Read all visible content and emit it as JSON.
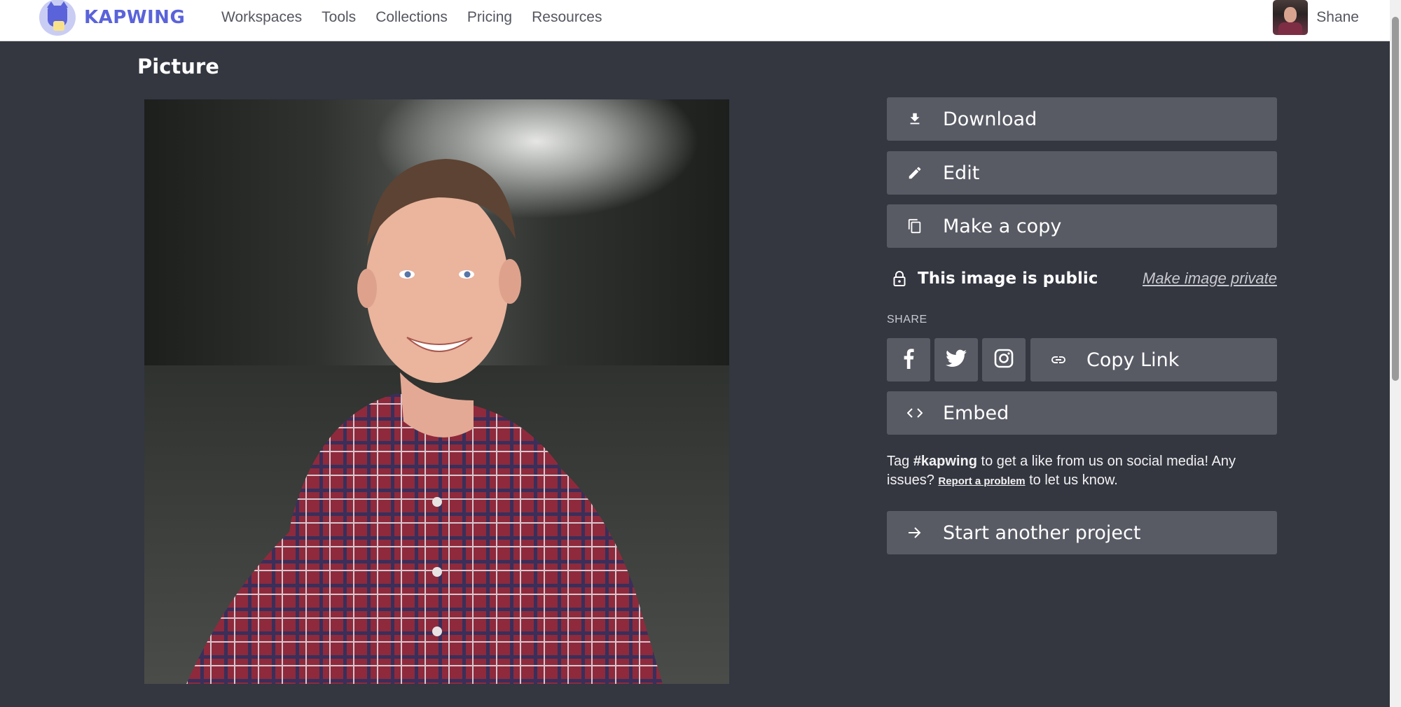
{
  "header": {
    "brand": "KAPWING",
    "nav": [
      "Workspaces",
      "Tools",
      "Collections",
      "Pricing",
      "Resources"
    ],
    "user_name": "Shane"
  },
  "page": {
    "title": "Picture"
  },
  "actions": {
    "download": "Download",
    "edit": "Edit",
    "copy": "Make a copy"
  },
  "privacy": {
    "status": "This image is public",
    "toggle": "Make image private"
  },
  "share": {
    "label": "SHARE",
    "copy_link": "Copy Link",
    "embed": "Embed"
  },
  "tag": {
    "prefix": "Tag ",
    "hashtag": "#kapwing",
    "middle": " to get a like from us on social media! Any issues? ",
    "report": "Report a problem",
    "suffix": " to let us know."
  },
  "start_project": "Start another project",
  "colors": {
    "brand": "#5a63d9",
    "background": "#343640",
    "button": "#585a64"
  }
}
